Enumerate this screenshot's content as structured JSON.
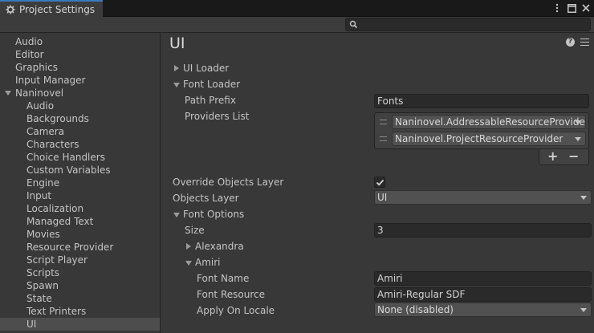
{
  "window": {
    "tab_title": "Project Settings",
    "search_placeholder": ""
  },
  "sidebar": {
    "items": [
      {
        "label": "Audio",
        "level": 0
      },
      {
        "label": "Editor",
        "level": 0
      },
      {
        "label": "Graphics",
        "level": 0
      },
      {
        "label": "Input Manager",
        "level": 0
      },
      {
        "label": "Naninovel",
        "level": 0,
        "expanded": true
      },
      {
        "label": "Audio",
        "level": 1
      },
      {
        "label": "Backgrounds",
        "level": 1
      },
      {
        "label": "Camera",
        "level": 1
      },
      {
        "label": "Characters",
        "level": 1
      },
      {
        "label": "Choice Handlers",
        "level": 1
      },
      {
        "label": "Custom Variables",
        "level": 1
      },
      {
        "label": "Engine",
        "level": 1
      },
      {
        "label": "Input",
        "level": 1
      },
      {
        "label": "Localization",
        "level": 1
      },
      {
        "label": "Managed Text",
        "level": 1
      },
      {
        "label": "Movies",
        "level": 1
      },
      {
        "label": "Resource Provider",
        "level": 1
      },
      {
        "label": "Script Player",
        "level": 1
      },
      {
        "label": "Scripts",
        "level": 1
      },
      {
        "label": "Spawn",
        "level": 1
      },
      {
        "label": "State",
        "level": 1
      },
      {
        "label": "Text Printers",
        "level": 1
      },
      {
        "label": "UI",
        "level": 1,
        "selected": true
      }
    ]
  },
  "main": {
    "title": "UI",
    "ui_loader": {
      "label": "UI Loader",
      "expanded": false
    },
    "font_loader": {
      "label": "Font Loader",
      "expanded": true,
      "path_prefix_label": "Path Prefix",
      "path_prefix_value": "Fonts",
      "providers_label": "Providers List",
      "providers": [
        "Naninovel.AddressableResourceProvider",
        "Naninovel.ProjectResourceProvider"
      ],
      "add_label": "+",
      "remove_label": "−"
    },
    "override_objects_layer": {
      "label": "Override Objects Layer",
      "checked": true
    },
    "objects_layer": {
      "label": "Objects Layer",
      "value": "UI"
    },
    "font_options": {
      "label": "Font Options",
      "expanded": true,
      "size_label": "Size",
      "size_value": "3",
      "entries": [
        {
          "label": "Alexandra",
          "expanded": false
        },
        {
          "label": "Amiri",
          "expanded": true
        }
      ],
      "amiri": {
        "font_name_label": "Font Name",
        "font_name_value": "Amiri",
        "font_resource_label": "Font Resource",
        "font_resource_value": "Amiri-Regular SDF",
        "apply_on_locale_label": "Apply On Locale",
        "apply_on_locale_value": "None (disabled)"
      }
    }
  },
  "colors": {
    "accent": "#3a79bb",
    "background": "#383838",
    "field": "#2a2a2a",
    "selected_row": "#4d4d4d"
  }
}
